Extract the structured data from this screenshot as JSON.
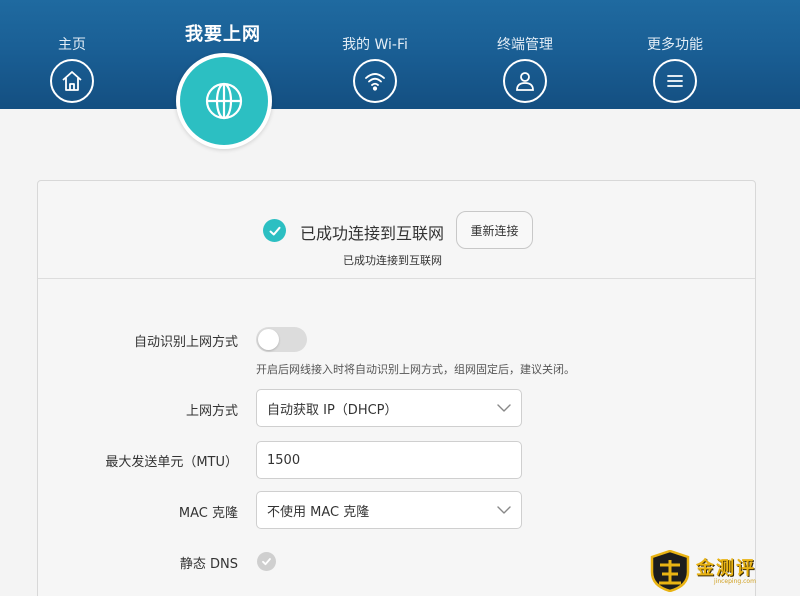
{
  "nav": {
    "items": [
      {
        "label": "主页",
        "icon": "home-icon"
      },
      {
        "label": "我要上网",
        "icon": "globe-icon",
        "active": true
      },
      {
        "label": "我的 Wi-Fi",
        "icon": "wifi-icon"
      },
      {
        "label": "终端管理",
        "icon": "user-icon"
      },
      {
        "label": "更多功能",
        "icon": "menu-icon"
      }
    ]
  },
  "status": {
    "title": "已成功连接到互联网",
    "subtitle": "已成功连接到互联网",
    "reconnect_label": "重新连接"
  },
  "form": {
    "auto_detect": {
      "label": "自动识别上网方式",
      "enabled": false,
      "hint": "开启后网线接入时将自动识别上网方式，组网固定后，建议关闭。"
    },
    "connection_type": {
      "label": "上网方式",
      "value": "自动获取 IP（DHCP）"
    },
    "mtu": {
      "label": "最大发送单元（MTU）",
      "value": "1500"
    },
    "mac_clone": {
      "label": "MAC 克隆",
      "value": "不使用 MAC 克隆"
    },
    "static_dns": {
      "label": "静态 DNS",
      "checked": false
    }
  },
  "watermark": {
    "text": "金测评",
    "url": "jinceping.com"
  },
  "colors": {
    "accent": "#2cbfc2",
    "header": "#1a5f95"
  }
}
